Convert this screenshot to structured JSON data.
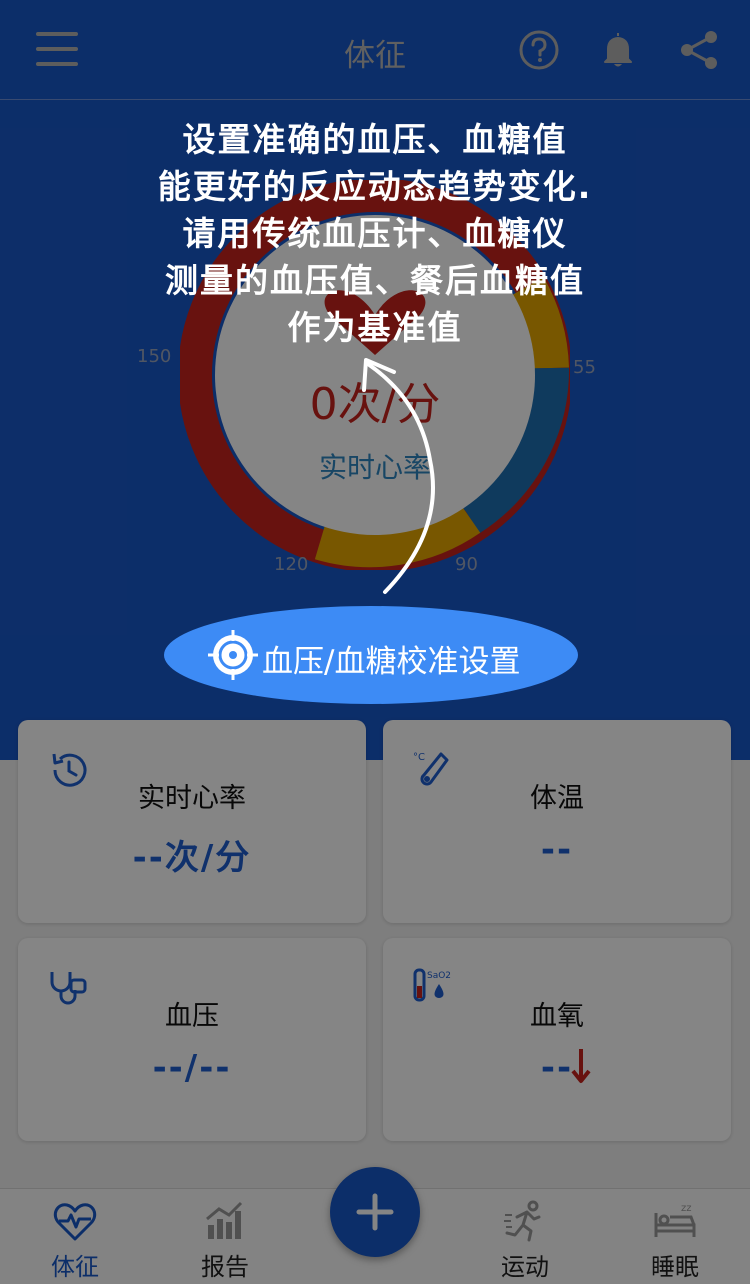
{
  "header": {
    "title": "体征",
    "icons": [
      "menu-icon",
      "help-icon",
      "bell-icon",
      "share-icon"
    ]
  },
  "gauge": {
    "value_text": "0次/分",
    "caption": "实时心率",
    "tick_labels": [
      "150",
      "55",
      "120",
      "90"
    ],
    "segment_colors": [
      "#c8241d",
      "#e6a800",
      "#1e6fb3"
    ]
  },
  "cards": [
    {
      "title": "实时心率",
      "value": "--次/分",
      "icon": "history-icon"
    },
    {
      "title": "体温",
      "value": "--",
      "icon": "thermometer-icon"
    },
    {
      "title": "血压",
      "value": "--/--",
      "icon": "stethoscope-icon"
    },
    {
      "title": "血氧",
      "value": "--",
      "icon": "spo2-icon",
      "trend": "down"
    }
  ],
  "nav": {
    "vitals": "体征",
    "report": "报告",
    "sport": "运动",
    "sleep": "睡眠"
  },
  "guide": {
    "lines": [
      "设置准确的血压、血糖值",
      "能更好的反应动态趋势变化.",
      "请用传统血压计、血糖仪",
      "测量的血压值、餐后血糖值",
      "作为基准值"
    ],
    "button_label": "血压/血糖校准设置"
  },
  "colors": {
    "primary": "#1858c9",
    "accent": "#3d8bf5",
    "alert": "#c8241d"
  }
}
